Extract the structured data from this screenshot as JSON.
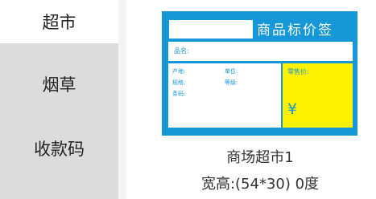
{
  "sidebar": {
    "items": [
      {
        "label": "超市",
        "active": true
      },
      {
        "label": "烟草",
        "active": false
      },
      {
        "label": "收款码",
        "active": false
      }
    ]
  },
  "label_preview": {
    "title": "商品标价签",
    "fields": {
      "name": "品名:",
      "origin": "产地:",
      "unit": "单位:",
      "spec": "规格:",
      "grade": "等级:",
      "barcode": "条码:",
      "retail_price": "零售价:"
    },
    "currency_symbol": "¥",
    "colors": {
      "frame": "#1597d8",
      "price_background": "#fef200",
      "field_text": "#1597d8"
    }
  },
  "template": {
    "name": "商场超市1",
    "size_info": "宽高:(54*30) 0度"
  }
}
